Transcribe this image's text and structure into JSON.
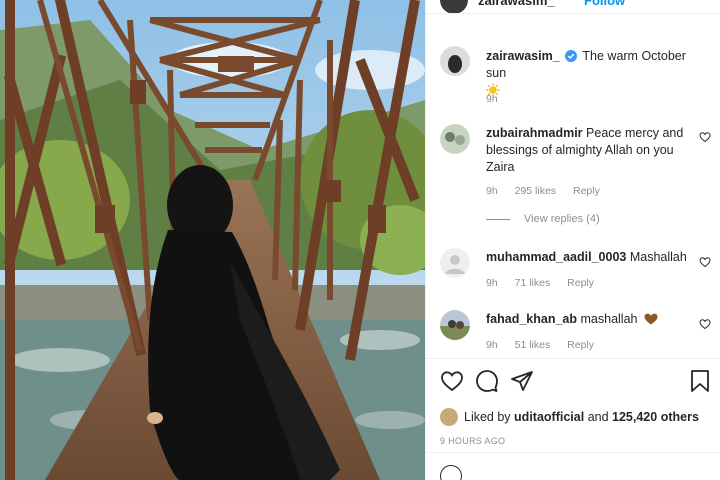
{
  "post_header": {
    "username": "zairawasim_",
    "follow_label": "Follow"
  },
  "caption": {
    "username": "zairawasim_",
    "text": "The warm October sun",
    "time": "9h",
    "verified_icon": "verified-badge-icon",
    "emoji_icon": "sun-emoji-icon"
  },
  "comments": [
    {
      "username": "zubairahmadmir",
      "text": "Peace mercy and blessings of almighty Allah on you Zaira",
      "time": "9h",
      "likes": "295 likes",
      "reply": "Reply",
      "view_replies": "View replies (4)"
    },
    {
      "username": "muhammad_aadil_0003",
      "text": "Mashallah",
      "time": "9h",
      "likes": "71 likes",
      "reply": "Reply"
    },
    {
      "username": "fahad_khan_ab",
      "text": "mashallah",
      "time": "9h",
      "likes": "51 likes",
      "reply": "Reply",
      "emoji_icon": "brown-heart-emoji-icon"
    }
  ],
  "actions": {
    "icons": [
      "heart-icon",
      "comment-icon",
      "share-icon",
      "bookmark-icon"
    ]
  },
  "likes_summary": {
    "prefix": "Liked by",
    "user": "uditaofficial",
    "middle": "and",
    "count": "125,420 others"
  },
  "timestamp": "9 HOURS AGO",
  "colors": {
    "link_blue": "#0095f6",
    "muted_gray": "#8e8e8e",
    "text": "#262626",
    "divider": "#efefef",
    "bridge_rust": "#7a4a2e",
    "sun_yellow": "#f5c518",
    "brown_heart": "#8b5a2b"
  }
}
